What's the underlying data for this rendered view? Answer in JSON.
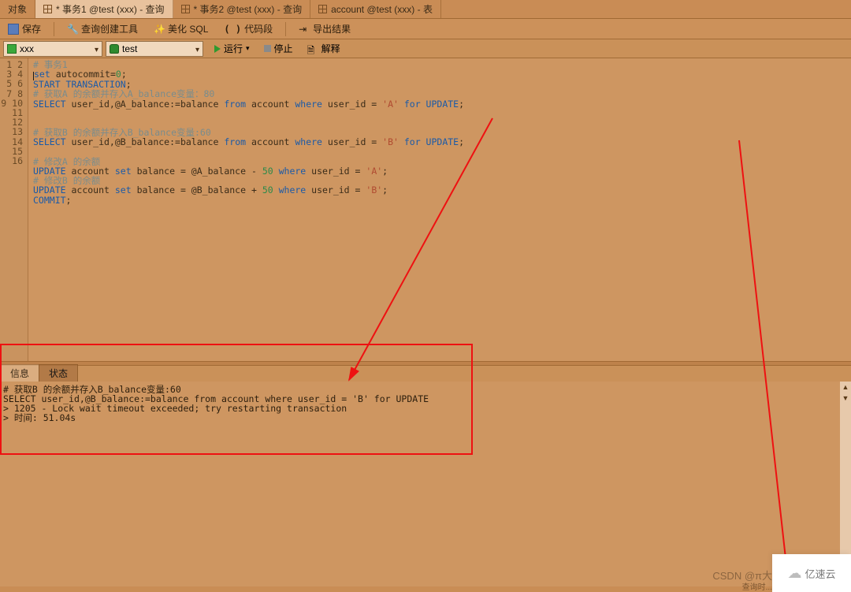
{
  "tabs": {
    "objects": "对象",
    "t1": "* 事务1 @test (xxx) - 查询",
    "t2": "* 事务2 @test (xxx) - 查询",
    "t3": "account @test (xxx) - 表"
  },
  "toolbar": {
    "save": "保存",
    "query_builder": "查询创建工具",
    "beautify": "美化 SQL",
    "braces": "( )",
    "code_seg": "代码段",
    "export": "导出结果"
  },
  "conn": {
    "connection": "xxx",
    "database": "test",
    "run": "运行",
    "run_caret": "▾",
    "stop": "停止",
    "explain": "解释"
  },
  "editor": {
    "line_count": 16,
    "lines": [
      [
        [
          "c-comment",
          "# 事务1"
        ]
      ],
      [
        [
          "cursor",
          ""
        ],
        [
          "c-kw",
          "set "
        ],
        [
          "c-id",
          "autocommit="
        ],
        [
          "c-num",
          "0"
        ],
        [
          "c-id",
          ";"
        ]
      ],
      [
        [
          "c-kw",
          "START TRANSACTION"
        ],
        [
          "c-id",
          ";"
        ]
      ],
      [
        [
          "c-comment",
          "# 获取A 的余额并存入A_balance变量：80"
        ]
      ],
      [
        [
          "c-kw",
          "SELECT "
        ],
        [
          "c-id",
          "user_id,@A_balance:=balance "
        ],
        [
          "c-kw2",
          "from "
        ],
        [
          "c-id",
          "account "
        ],
        [
          "c-kw2",
          "where "
        ],
        [
          "c-id",
          "user_id = "
        ],
        [
          "c-str",
          "'A'"
        ],
        [
          "c-kw2",
          " for UPDATE"
        ],
        [
          "c-id",
          ";"
        ]
      ],
      [],
      [],
      [
        [
          "c-comment",
          "# 获取B 的余额并存入B_balance变量:60"
        ]
      ],
      [
        [
          "c-kw",
          "SELECT "
        ],
        [
          "c-id",
          "user_id,@B_balance:=balance "
        ],
        [
          "c-kw2",
          "from "
        ],
        [
          "c-id",
          "account "
        ],
        [
          "c-kw2",
          "where "
        ],
        [
          "c-id",
          "user_id = "
        ],
        [
          "c-str",
          "'B'"
        ],
        [
          "c-kw2",
          " for UPDATE"
        ],
        [
          "c-id",
          ";"
        ]
      ],
      [],
      [
        [
          "c-comment",
          "# 修改A 的余额"
        ]
      ],
      [
        [
          "c-kw",
          "UPDATE "
        ],
        [
          "c-id",
          "account "
        ],
        [
          "c-kw",
          "set "
        ],
        [
          "c-id",
          "balance = @A_balance - "
        ],
        [
          "c-num",
          "50"
        ],
        [
          "c-kw2",
          " where "
        ],
        [
          "c-id",
          "user_id = "
        ],
        [
          "c-str",
          "'A'"
        ],
        [
          "c-id",
          ";"
        ]
      ],
      [
        [
          "c-comment",
          "# 修改B 的余额"
        ]
      ],
      [
        [
          "c-kw",
          "UPDATE "
        ],
        [
          "c-id",
          "account "
        ],
        [
          "c-kw",
          "set "
        ],
        [
          "c-id",
          "balance = @B_balance + "
        ],
        [
          "c-num",
          "50"
        ],
        [
          "c-kw2",
          " where "
        ],
        [
          "c-id",
          "user_id = "
        ],
        [
          "c-str",
          "'B'"
        ],
        [
          "c-id",
          ";"
        ]
      ],
      [
        [
          "c-kw",
          "COMMIT"
        ],
        [
          "c-id",
          ";"
        ]
      ],
      []
    ]
  },
  "result_tabs": {
    "info": "信息",
    "status": "状态"
  },
  "messages": "# 获取B 的余额并存入B_balance变量:60\nSELECT user_id,@B_balance:=balance from account where user_id = 'B' for UPDATE\n> 1205 - Lock wait timeout exceeded; try restarting transaction\n> 时间: 51.04s",
  "watermark": {
    "csdn": "CSDN @π大",
    "brand": "亿速云",
    "status_tiny": "查询时..."
  }
}
